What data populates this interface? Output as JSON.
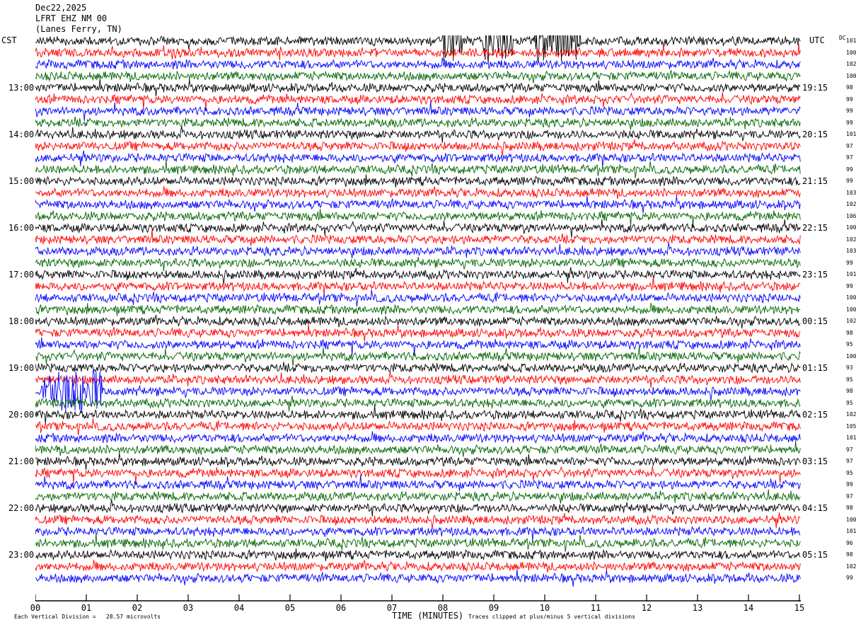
{
  "header": {
    "date": "Dec22,2025",
    "station": "LFRT EHZ NM 00",
    "location": "(Lanes Ferry, TN)"
  },
  "left_axis_title": "CST",
  "right_axis_title": "UTC",
  "dc_axis_title": "DC",
  "footer": {
    "left_note": "Each Vertical Division =   28.57 microvolts",
    "xlabel": "TIME (MINUTES)",
    "right_note": "Traces clipped at plus/minus 5 vertical divisions"
  },
  "colors": {
    "trace_cycle": [
      "#000000",
      "#ff0000",
      "#0000ff",
      "#006400"
    ]
  },
  "chart_data": {
    "type": "line",
    "title": "LFRT EHZ NM 00",
    "xlabel": "TIME (MINUTES)",
    "xlim": [
      0,
      15
    ],
    "x_ticks": [
      "00",
      "01",
      "02",
      "03",
      "04",
      "05",
      "06",
      "07",
      "08",
      "09",
      "10",
      "11",
      "12",
      "13",
      "14",
      "15"
    ],
    "cst_hour_labels": [
      "13:00",
      "14:00",
      "15:00",
      "16:00",
      "17:00",
      "18:00",
      "19:00",
      "20:00",
      "21:00",
      "22:00",
      "23:00"
    ],
    "utc_hour_labels": [
      "19:15",
      "20:15",
      "21:15",
      "22:15",
      "23:15",
      "00:15",
      "01:15",
      "02:15",
      "03:15",
      "04:15",
      "05:15"
    ],
    "traces_per_hour": 4,
    "dc_offsets": [
      101,
      100,
      102,
      100,
      98,
      99,
      99,
      99,
      101,
      97,
      97,
      99,
      99,
      103,
      102,
      106,
      100,
      102,
      103,
      99,
      101,
      99,
      100,
      100,
      102,
      98,
      95,
      100,
      93,
      95,
      98,
      95,
      102,
      105,
      101,
      97,
      97,
      95,
      99,
      97,
      98,
      100,
      101,
      96,
      98,
      102,
      99
    ],
    "events": [
      {
        "trace": 0,
        "minute_range": [
          8.0,
          8.4
        ],
        "note": "clipped burst"
      },
      {
        "trace": 0,
        "minute_range": [
          8.8,
          9.4
        ],
        "note": "clipped burst"
      },
      {
        "trace": 0,
        "minute_range": [
          9.8,
          10.7
        ],
        "note": "clipped burst"
      },
      {
        "trace": 30,
        "minute_range": [
          0.1,
          1.3
        ],
        "note": "burst"
      }
    ]
  }
}
